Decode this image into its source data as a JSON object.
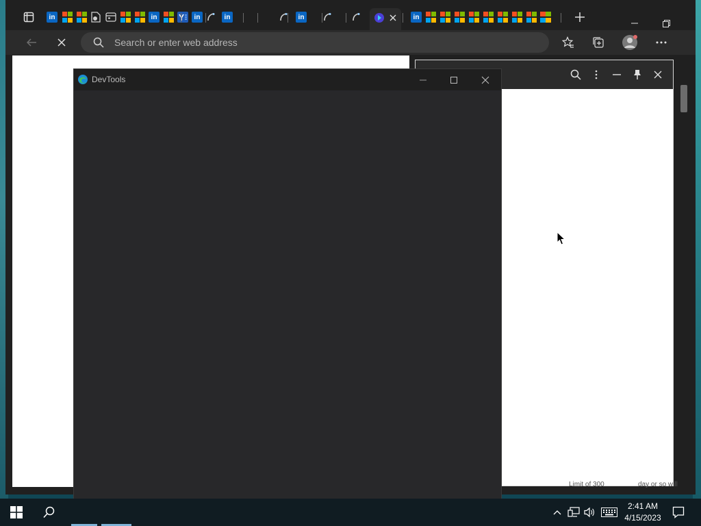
{
  "browser": {
    "address_placeholder": "Search or enter web address",
    "tabs": [
      {
        "icon": "linkedin-icon"
      },
      {
        "icon": "microsoft-icon"
      },
      {
        "icon": "microsoft-icon"
      },
      {
        "icon": "document-icon"
      },
      {
        "icon": "calendar-icon"
      },
      {
        "icon": "microsoft-icon"
      },
      {
        "icon": "microsoft-icon"
      },
      {
        "icon": "linkedin-icon"
      },
      {
        "icon": "microsoft-icon"
      },
      {
        "icon": "yammer-icon"
      },
      {
        "icon": "linkedin-icon"
      },
      {
        "icon": "loading-icon"
      },
      {
        "icon": "linkedin-icon"
      },
      {
        "icon": "loading-icon"
      },
      {
        "icon": "linkedin-icon"
      },
      {
        "icon": "loading-icon"
      },
      {
        "icon": "loading-icon"
      },
      {
        "icon": "bing-icon"
      },
      {
        "icon": "linkedin-icon"
      },
      {
        "icon": "microsoft-icon"
      },
      {
        "icon": "microsoft-icon"
      },
      {
        "icon": "microsoft-icon"
      },
      {
        "icon": "microsoft-icon"
      },
      {
        "icon": "microsoft-icon"
      },
      {
        "icon": "microsoft-icon"
      },
      {
        "icon": "microsoft-icon"
      },
      {
        "icon": "microsoft-icon"
      },
      {
        "icon": "microsoft-icon"
      },
      {
        "icon": "microsoft-icon"
      }
    ],
    "status_left": "Limit of 300",
    "status_right": "day or so will"
  },
  "devtools": {
    "title": "DevTools"
  },
  "taskbar": {
    "time": "2:41 AM",
    "date": "4/15/2023"
  },
  "colors": {
    "accent": "#0a66c2",
    "devtools_bg": "#28282a",
    "taskbar_bg": "#101c22"
  }
}
